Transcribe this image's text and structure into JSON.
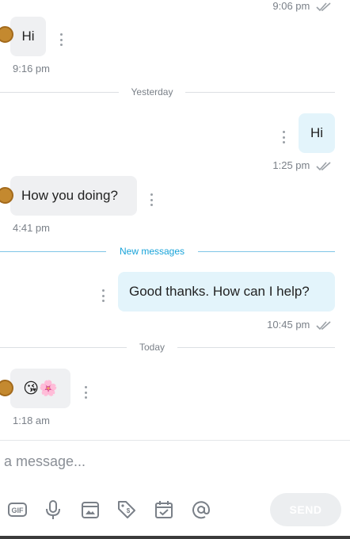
{
  "messages": [
    {
      "id": "m0",
      "direction": "outgoing",
      "time": "9:06 pm",
      "status": "read"
    },
    {
      "id": "m1",
      "direction": "incoming",
      "text": "Hi",
      "time": "9:16 pm"
    },
    {
      "id": "m2",
      "direction": "outgoing",
      "text": "Hi",
      "time": "1:25 pm",
      "status": "read"
    },
    {
      "id": "m3",
      "direction": "incoming",
      "text": "How you doing?",
      "time": "4:41 pm"
    },
    {
      "id": "m4",
      "direction": "outgoing",
      "text": "Good thanks. How can I help?",
      "time": "10:45 pm",
      "status": "read"
    },
    {
      "id": "m5",
      "direction": "incoming",
      "text": "😘🌸",
      "time": "1:18 am"
    }
  ],
  "dividers": {
    "yesterday": "Yesterday",
    "new_messages": "New messages",
    "today": "Today"
  },
  "composer": {
    "placeholder": "a message...",
    "send_label": "SEND",
    "tools": [
      "gif-icon",
      "microphone-icon",
      "media-icon",
      "price-tag-icon",
      "calendar-check-icon",
      "mention-icon"
    ]
  },
  "colors": {
    "incoming_bubble": "#eff0f2",
    "outgoing_bubble": "#e3f4fb",
    "new_messages_accent": "#18a3d9",
    "avatar": "#c4892f"
  }
}
